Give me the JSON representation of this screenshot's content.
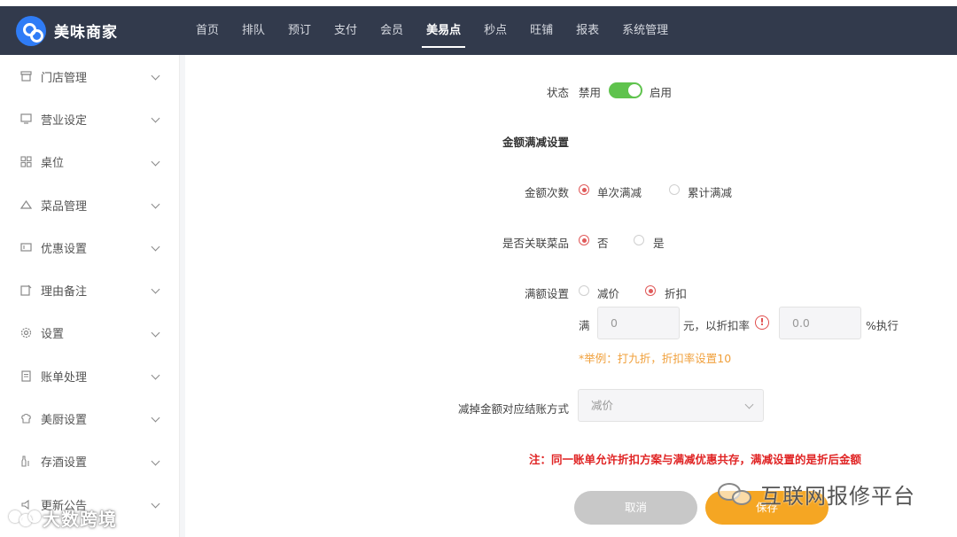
{
  "app": {
    "title": "美味商家"
  },
  "nav": {
    "items": [
      {
        "label": "首页",
        "active": false
      },
      {
        "label": "排队",
        "active": false
      },
      {
        "label": "预订",
        "active": false
      },
      {
        "label": "支付",
        "active": false
      },
      {
        "label": "会员",
        "active": false
      },
      {
        "label": "美易点",
        "active": true
      },
      {
        "label": "秒点",
        "active": false
      },
      {
        "label": "旺铺",
        "active": false
      },
      {
        "label": "报表",
        "active": false
      },
      {
        "label": "系统管理",
        "active": false
      }
    ]
  },
  "sidebar": {
    "items": [
      {
        "label": "门店管理",
        "icon": "store-icon"
      },
      {
        "label": "营业设定",
        "icon": "monitor-icon"
      },
      {
        "label": "桌位",
        "icon": "grid-icon"
      },
      {
        "label": "菜品管理",
        "icon": "dish-icon"
      },
      {
        "label": "优惠设置",
        "icon": "coupon-icon"
      },
      {
        "label": "理由备注",
        "icon": "note-icon"
      },
      {
        "label": "设置",
        "icon": "gear-icon"
      },
      {
        "label": "账单处理",
        "icon": "bill-icon"
      },
      {
        "label": "美厨设置",
        "icon": "chef-icon"
      },
      {
        "label": "存酒设置",
        "icon": "bottle-icon"
      },
      {
        "label": "更新公告",
        "icon": "announcement-icon"
      }
    ]
  },
  "form": {
    "status": {
      "label": "状态",
      "off_label": "禁用",
      "on_label": "启用",
      "enabled": true
    },
    "section_title": "金额满减设置",
    "amount_times": {
      "label": "金额次数",
      "options": [
        "单次满减",
        "累计满减"
      ],
      "selected": "单次满减"
    },
    "link_dish": {
      "label": "是否关联菜品",
      "options": [
        "否",
        "是"
      ],
      "selected": "否"
    },
    "full_reduce": {
      "label": "满额设置",
      "options": [
        "减价",
        "折扣"
      ],
      "selected": "折扣",
      "prefix": "满",
      "amount_value": "0",
      "middle_text": "元，以折扣率",
      "rate_value": "0.0",
      "suffix": "%执行",
      "hint": "*举例：打九折，折扣率设置10"
    },
    "settle_method": {
      "label": "减掉金额对应结账方式",
      "value": "减价"
    },
    "note": "注：同一账单允许折扣方案与满减优惠共存，满减设置的是折后金额",
    "buttons": {
      "cancel": "取消",
      "save": "保存"
    }
  },
  "watermarks": {
    "right": "互联网报修平台",
    "left": "大数跨境"
  },
  "colors": {
    "topbar": "#323a4c",
    "accent_blue": "#3d8ee6",
    "toggle_on": "#5fc34d",
    "radio_on": "#e05a5a",
    "save": "#f5a623",
    "cancel": "#c8c8c8",
    "note": "#e02424",
    "hint": "#f0a03c"
  }
}
